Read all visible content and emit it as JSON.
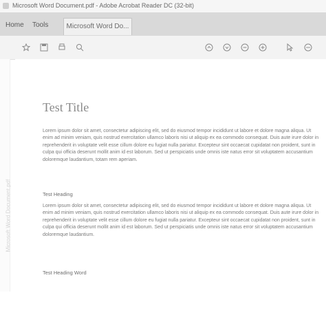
{
  "window": {
    "title": "Microsoft Word Document.pdf - Adobe Acrobat Reader DC (32-bit)"
  },
  "tabs": {
    "home": "Home",
    "tools": "Tools",
    "document": "Microsoft Word Do..."
  },
  "toolbar": {
    "icons": [
      "star-icon",
      "save-icon",
      "print-icon",
      "search-icon",
      "prev-page-icon",
      "next-page-icon",
      "zoom-out-icon",
      "zoom-in-icon",
      "select-icon",
      "more-icon"
    ]
  },
  "sidebar": {
    "vertical_label": "Microsoft Word Document.pdf"
  },
  "document": {
    "title": "Test Title",
    "paragraph1": "Lorem ipsum dolor sit amet, consectetur adipiscing elit, sed do eiusmod tempor incididunt ut labore et dolore magna aliqua. Ut enim ad minim veniam, quis nostrud exercitation ullamco laboris nisi ut aliquip ex ea commodo consequat. Duis aute irure dolor in reprehenderit in voluptate velit esse cillum dolore eu fugiat nulla pariatur. Excepteur sint occaecat cupidatat non proident, sunt in culpa qui officia deserunt mollit anim id est laborum. Sed ut perspiciatis unde omnis iste natus error sit voluptatem accusantium doloremque laudantium, totam rem aperiam.",
    "heading2": "Test Heading",
    "paragraph2": "Lorem ipsum dolor sit amet, consectetur adipiscing elit, sed do eiusmod tempor incididunt ut labore et dolore magna aliqua. Ut enim ad minim veniam, quis nostrud exercitation ullamco laboris nisi ut aliquip ex ea commodo consequat. Duis aute irure dolor in reprehenderit in voluptate velit esse cillum dolore eu fugiat nulla pariatur. Excepteur sint occaecat cupidatat non proident, sunt in culpa qui officia deserunt mollit anim id est laborum. Sed ut perspiciatis unde omnis iste natus error sit voluptatem accusantium doloremque laudantium.",
    "heading3": "Test Heading Word"
  }
}
